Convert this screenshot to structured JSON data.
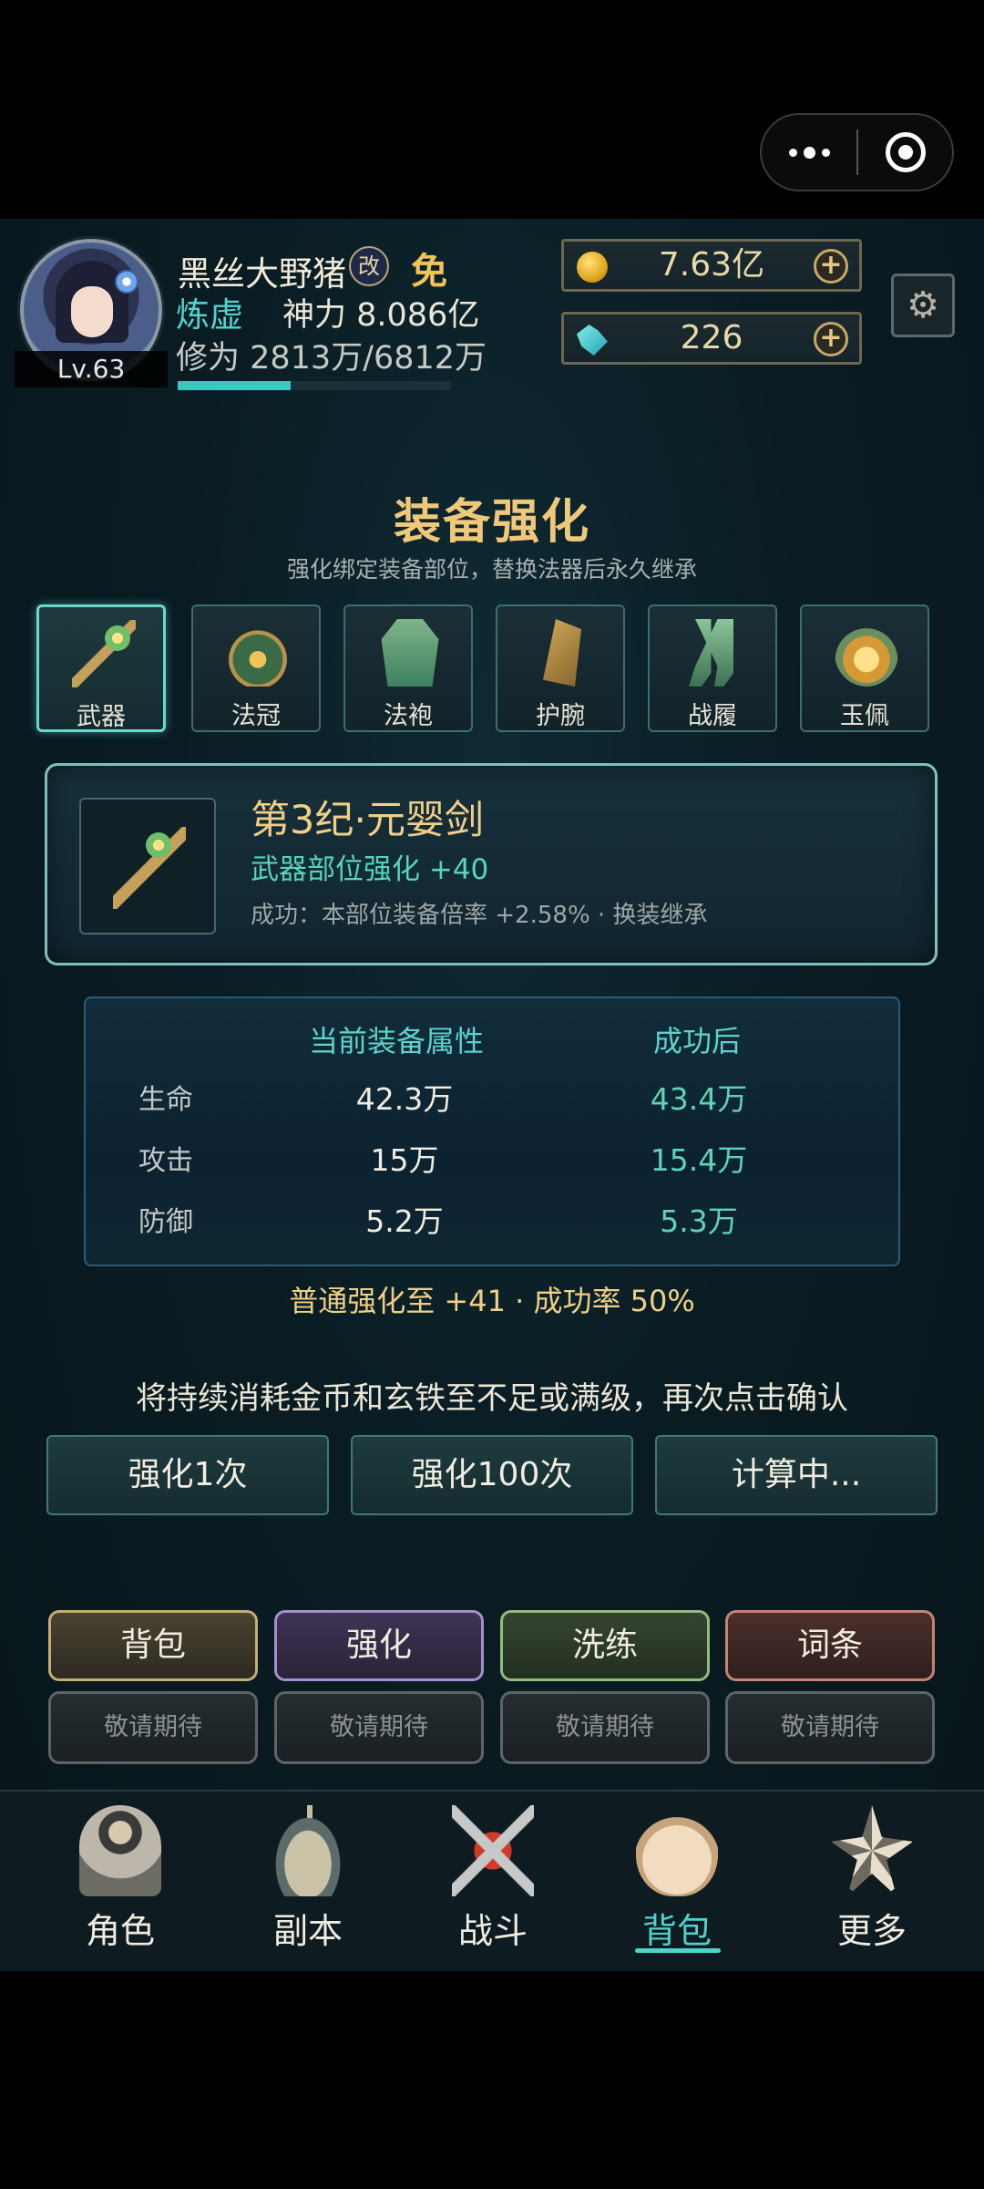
{
  "player": {
    "name": "黑丝大野猪",
    "gai_badge": "改",
    "mian_badge": "免",
    "level": "Lv.63",
    "realm": "炼虚",
    "power": "神力 8.086亿",
    "cultivation": "修为 2813万/6812万",
    "cultivation_progress": 0.413
  },
  "resources": {
    "gold": "7.63亿",
    "crystal": "226",
    "plus_symbol": "+"
  },
  "page": {
    "title": "装备强化",
    "subtitle": "强化绑定装备部位，替换法器后永久继承"
  },
  "slots": [
    {
      "label": "武器",
      "icon": "staff-icon",
      "active": true
    },
    {
      "label": "法冠",
      "icon": "crown-icon",
      "active": false
    },
    {
      "label": "法袍",
      "icon": "robe-icon",
      "active": false
    },
    {
      "label": "护腕",
      "icon": "bracer-icon",
      "active": false
    },
    {
      "label": "战履",
      "icon": "boots-icon",
      "active": false
    },
    {
      "label": "玉佩",
      "icon": "jade-icon",
      "active": false
    }
  ],
  "item": {
    "name": "第3纪·元婴剑",
    "enhance": "武器部位强化 +40",
    "desc": "成功：本部位装备倍率 +2.58% · 换装继承"
  },
  "stats": {
    "col_current": "当前装备属性",
    "col_after": "成功后",
    "rows": [
      {
        "key": "生命",
        "current": "42.3万",
        "after": "43.4万"
      },
      {
        "key": "攻击",
        "current": "15万",
        "after": "15.4万"
      },
      {
        "key": "防御",
        "current": "5.2万",
        "after": "5.3万"
      }
    ]
  },
  "rate_text": "普通强化至 +41 · 成功率 50%",
  "notice": "将持续消耗金币和玄铁至不足或满级，再次点击确认",
  "actions": {
    "once": "强化1次",
    "hundred": "强化100次",
    "calc": "计算中..."
  },
  "menu": {
    "bag": "背包",
    "enhance": "强化",
    "wash": "洗练",
    "affix": "词条",
    "coming_soon": "敬请期待"
  },
  "nav": {
    "role": "角色",
    "dungeon": "副本",
    "battle": "战斗",
    "bag": "背包",
    "more": "更多",
    "active": "bag"
  },
  "colors": {
    "accent": "#4fd3cf",
    "gold_text": "#f0cf86",
    "background": "#0a1c23"
  }
}
